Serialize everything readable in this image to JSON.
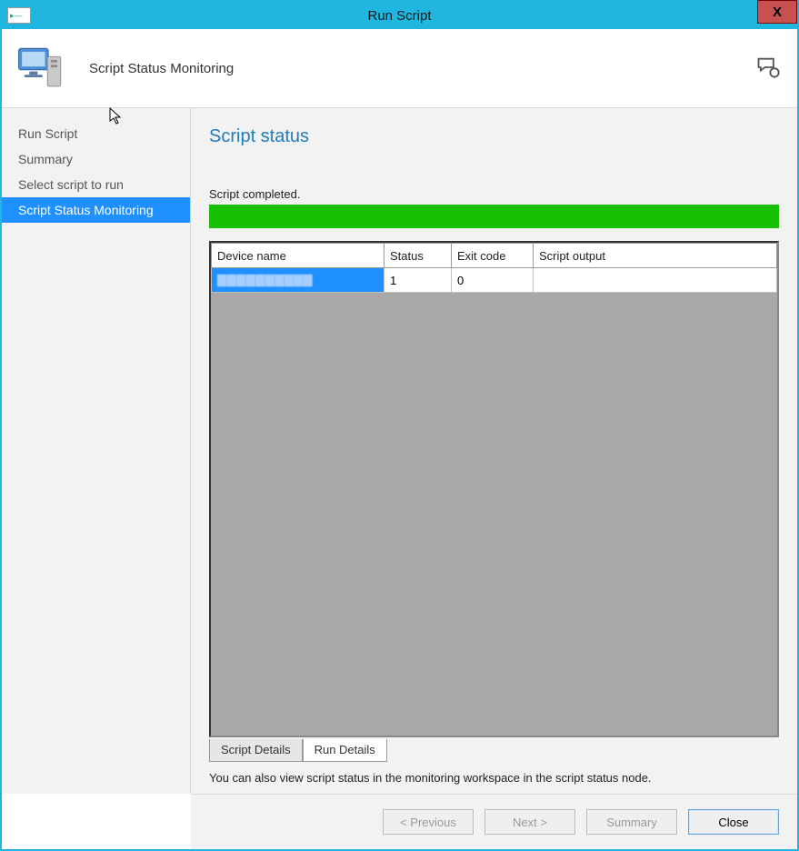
{
  "window": {
    "title": "Run Script"
  },
  "header": {
    "page_title": "Script Status Monitoring"
  },
  "sidebar": {
    "items": [
      {
        "label": "Run Script",
        "active": false
      },
      {
        "label": "Summary",
        "active": false
      },
      {
        "label": "Select script to run",
        "active": false
      },
      {
        "label": "Script Status Monitoring",
        "active": true
      }
    ]
  },
  "main": {
    "heading": "Script status",
    "status_text": "Script completed.",
    "progress_percent": 100,
    "table": {
      "columns": [
        "Device name",
        "Status",
        "Exit code",
        "Script output"
      ],
      "rows": [
        {
          "device_name": "▇▇▇▇▇▇▇▇▇▇",
          "status": "1",
          "exit_code": "0",
          "script_output": "",
          "selected": true
        }
      ]
    },
    "tabs": [
      {
        "label": "Script Details",
        "active": false
      },
      {
        "label": "Run Details",
        "active": true
      }
    ],
    "hint": "You can also view script status in the monitoring workspace in the script status node."
  },
  "footer": {
    "previous": "< Previous",
    "next": "Next >",
    "summary": "Summary",
    "close": "Close"
  },
  "colors": {
    "titlebar": "#1fb6e0",
    "accent": "#1e90ff",
    "progress": "#17c000",
    "heading": "#1e7dbd"
  }
}
